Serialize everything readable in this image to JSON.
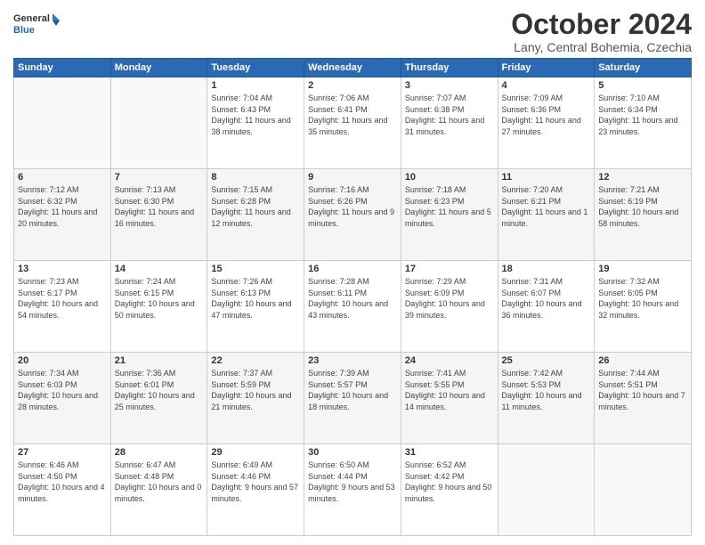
{
  "logo": {
    "general": "General",
    "blue": "Blue"
  },
  "header": {
    "month": "October 2024",
    "location": "Lany, Central Bohemia, Czechia"
  },
  "days_of_week": [
    "Sunday",
    "Monday",
    "Tuesday",
    "Wednesday",
    "Thursday",
    "Friday",
    "Saturday"
  ],
  "weeks": [
    [
      {
        "day": "",
        "info": ""
      },
      {
        "day": "",
        "info": ""
      },
      {
        "day": "1",
        "info": "Sunrise: 7:04 AM\nSunset: 6:43 PM\nDaylight: 11 hours and 38 minutes."
      },
      {
        "day": "2",
        "info": "Sunrise: 7:06 AM\nSunset: 6:41 PM\nDaylight: 11 hours and 35 minutes."
      },
      {
        "day": "3",
        "info": "Sunrise: 7:07 AM\nSunset: 6:38 PM\nDaylight: 11 hours and 31 minutes."
      },
      {
        "day": "4",
        "info": "Sunrise: 7:09 AM\nSunset: 6:36 PM\nDaylight: 11 hours and 27 minutes."
      },
      {
        "day": "5",
        "info": "Sunrise: 7:10 AM\nSunset: 6:34 PM\nDaylight: 11 hours and 23 minutes."
      }
    ],
    [
      {
        "day": "6",
        "info": "Sunrise: 7:12 AM\nSunset: 6:32 PM\nDaylight: 11 hours and 20 minutes."
      },
      {
        "day": "7",
        "info": "Sunrise: 7:13 AM\nSunset: 6:30 PM\nDaylight: 11 hours and 16 minutes."
      },
      {
        "day": "8",
        "info": "Sunrise: 7:15 AM\nSunset: 6:28 PM\nDaylight: 11 hours and 12 minutes."
      },
      {
        "day": "9",
        "info": "Sunrise: 7:16 AM\nSunset: 6:26 PM\nDaylight: 11 hours and 9 minutes."
      },
      {
        "day": "10",
        "info": "Sunrise: 7:18 AM\nSunset: 6:23 PM\nDaylight: 11 hours and 5 minutes."
      },
      {
        "day": "11",
        "info": "Sunrise: 7:20 AM\nSunset: 6:21 PM\nDaylight: 11 hours and 1 minute."
      },
      {
        "day": "12",
        "info": "Sunrise: 7:21 AM\nSunset: 6:19 PM\nDaylight: 10 hours and 58 minutes."
      }
    ],
    [
      {
        "day": "13",
        "info": "Sunrise: 7:23 AM\nSunset: 6:17 PM\nDaylight: 10 hours and 54 minutes."
      },
      {
        "day": "14",
        "info": "Sunrise: 7:24 AM\nSunset: 6:15 PM\nDaylight: 10 hours and 50 minutes."
      },
      {
        "day": "15",
        "info": "Sunrise: 7:26 AM\nSunset: 6:13 PM\nDaylight: 10 hours and 47 minutes."
      },
      {
        "day": "16",
        "info": "Sunrise: 7:28 AM\nSunset: 6:11 PM\nDaylight: 10 hours and 43 minutes."
      },
      {
        "day": "17",
        "info": "Sunrise: 7:29 AM\nSunset: 6:09 PM\nDaylight: 10 hours and 39 minutes."
      },
      {
        "day": "18",
        "info": "Sunrise: 7:31 AM\nSunset: 6:07 PM\nDaylight: 10 hours and 36 minutes."
      },
      {
        "day": "19",
        "info": "Sunrise: 7:32 AM\nSunset: 6:05 PM\nDaylight: 10 hours and 32 minutes."
      }
    ],
    [
      {
        "day": "20",
        "info": "Sunrise: 7:34 AM\nSunset: 6:03 PM\nDaylight: 10 hours and 28 minutes."
      },
      {
        "day": "21",
        "info": "Sunrise: 7:36 AM\nSunset: 6:01 PM\nDaylight: 10 hours and 25 minutes."
      },
      {
        "day": "22",
        "info": "Sunrise: 7:37 AM\nSunset: 5:59 PM\nDaylight: 10 hours and 21 minutes."
      },
      {
        "day": "23",
        "info": "Sunrise: 7:39 AM\nSunset: 5:57 PM\nDaylight: 10 hours and 18 minutes."
      },
      {
        "day": "24",
        "info": "Sunrise: 7:41 AM\nSunset: 5:55 PM\nDaylight: 10 hours and 14 minutes."
      },
      {
        "day": "25",
        "info": "Sunrise: 7:42 AM\nSunset: 5:53 PM\nDaylight: 10 hours and 11 minutes."
      },
      {
        "day": "26",
        "info": "Sunrise: 7:44 AM\nSunset: 5:51 PM\nDaylight: 10 hours and 7 minutes."
      }
    ],
    [
      {
        "day": "27",
        "info": "Sunrise: 6:46 AM\nSunset: 4:50 PM\nDaylight: 10 hours and 4 minutes."
      },
      {
        "day": "28",
        "info": "Sunrise: 6:47 AM\nSunset: 4:48 PM\nDaylight: 10 hours and 0 minutes."
      },
      {
        "day": "29",
        "info": "Sunrise: 6:49 AM\nSunset: 4:46 PM\nDaylight: 9 hours and 57 minutes."
      },
      {
        "day": "30",
        "info": "Sunrise: 6:50 AM\nSunset: 4:44 PM\nDaylight: 9 hours and 53 minutes."
      },
      {
        "day": "31",
        "info": "Sunrise: 6:52 AM\nSunset: 4:42 PM\nDaylight: 9 hours and 50 minutes."
      },
      {
        "day": "",
        "info": ""
      },
      {
        "day": "",
        "info": ""
      }
    ]
  ]
}
